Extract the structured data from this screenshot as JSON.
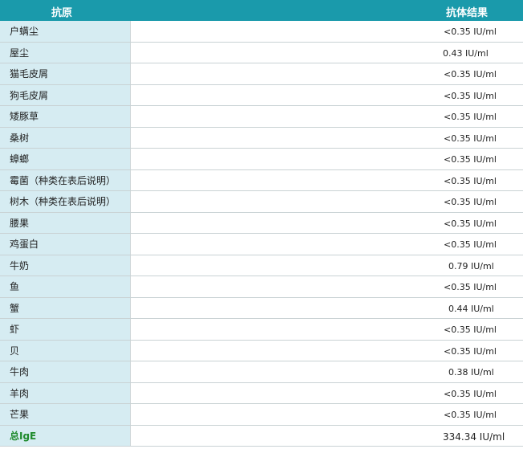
{
  "header": {
    "antigen": "抗原",
    "result": "抗体结果"
  },
  "rows": [
    {
      "antigen": "户螨尘",
      "result": "<0.35 IU/ml"
    },
    {
      "antigen": "屋尘",
      "result": "0.43 IU/ml"
    },
    {
      "antigen": "猫毛皮屑",
      "result": "<0.35 IU/ml"
    },
    {
      "antigen": "狗毛皮屑",
      "result": "<0.35 IU/ml"
    },
    {
      "antigen": "矮豚草",
      "result": "<0.35 IU/ml"
    },
    {
      "antigen": "桑树",
      "result": "<0.35 IU/ml"
    },
    {
      "antigen": "蟑螂",
      "result": "<0.35 IU/ml"
    },
    {
      "antigen": "霉菌（种类在表后说明）",
      "result": "<0.35 IU/ml"
    },
    {
      "antigen": "树木（种类在表后说明）",
      "result": "<0.35 IU/ml"
    },
    {
      "antigen": "腰果",
      "result": "<0.35 IU/ml"
    },
    {
      "antigen": "鸡蛋白",
      "result": "<0.35 IU/ml"
    },
    {
      "antigen": "牛奶",
      "result": "0.79 IU/ml"
    },
    {
      "antigen": "鱼",
      "result": "<0.35 IU/ml"
    },
    {
      "antigen": "蟹",
      "result": "0.44 IU/ml"
    },
    {
      "antigen": "虾",
      "result": "<0.35 IU/ml"
    },
    {
      "antigen": "贝",
      "result": "<0.35 IU/ml"
    },
    {
      "antigen": "牛肉",
      "result": "0.38 IU/ml"
    },
    {
      "antigen": "羊肉",
      "result": "<0.35 IU/ml"
    },
    {
      "antigen": "芒果",
      "result": "<0.35 IU/ml"
    }
  ],
  "total": {
    "antigen": "总IgE",
    "result": "334.34 IU/ml"
  }
}
